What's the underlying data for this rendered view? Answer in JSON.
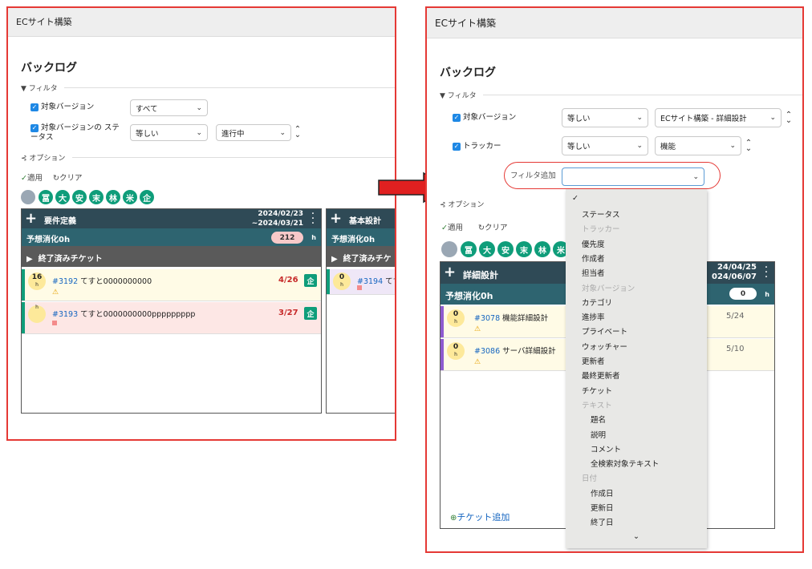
{
  "left": {
    "project_title": "ECサイト構築",
    "heading": "バックログ",
    "filter_section": "フィルタ",
    "filters": [
      {
        "label": "対象バージョン",
        "operator": "すべて"
      },
      {
        "label": "対象バージョンの ステータス",
        "operator": "等しい",
        "value": "進行中"
      }
    ],
    "options_section": "オプション",
    "apply": "適用",
    "clear": "クリア",
    "avatars": [
      "冨",
      "大",
      "安",
      "末",
      "林",
      "米",
      "企"
    ],
    "columns": [
      {
        "name": "要件定義",
        "dates": [
          "2024/02/23",
          "~2024/03/21"
        ],
        "estimate_label": "予想消化0h",
        "estimate_value": "212",
        "estimate_unit": "h",
        "closed_label": "終了済みチケット",
        "cards": [
          {
            "hours": "16",
            "unit": "h",
            "num": "#3192",
            "title": "てすと0000000000",
            "due": "4/26",
            "badge": "企",
            "warn": "⚠"
          },
          {
            "hours": "",
            "unit": "h",
            "num": "#3193",
            "title": "てすと0000000000ppppppppp",
            "due": "3/27",
            "badge": "企"
          }
        ]
      },
      {
        "name": "基本設計",
        "estimate_label": "予想消化0h",
        "closed_label": "終了済みチケ",
        "cards": [
          {
            "hours": "0",
            "unit": "h",
            "num": "#3194",
            "title": "てす"
          }
        ]
      }
    ]
  },
  "right": {
    "project_title": "ECサイト構築",
    "heading": "バックログ",
    "filter_section": "フィルタ",
    "filters": [
      {
        "label": "対象バージョン",
        "operator": "等しい",
        "value": "ECサイト構築 - 詳細設計"
      },
      {
        "label": "トラッカー",
        "operator": "等しい",
        "value": "機能"
      }
    ],
    "filter_add_label": "フィルタ追加",
    "options_section": "オプション",
    "apply": "適用",
    "clear": "クリア",
    "avatars": [
      "冨",
      "大",
      "安",
      "末",
      "林",
      "米"
    ],
    "column": {
      "name": "詳細設計",
      "dates": [
        "24/04/25",
        "024/06/07"
      ],
      "estimate_label": "予想消化0h",
      "estimate_value": "0",
      "estimate_unit": "h",
      "cards": [
        {
          "hours": "0",
          "unit": "h",
          "num": "#3078",
          "title": "機能詳細設計",
          "due": "5/24",
          "warn": "⚠"
        },
        {
          "hours": "0",
          "unit": "h",
          "num": "#3086",
          "title": "サーバ詳細設計",
          "due": "5/10",
          "warn": "⚠"
        }
      ]
    },
    "add_ticket": "チケット追加",
    "dropdown": {
      "check": "✓",
      "items": [
        {
          "label": "ステータス",
          "disabled": false
        },
        {
          "label": "トラッカー",
          "disabled": true
        },
        {
          "label": "優先度",
          "disabled": false
        },
        {
          "label": "作成者",
          "disabled": false
        },
        {
          "label": "担当者",
          "disabled": false
        },
        {
          "label": "対象バージョン",
          "disabled": true
        },
        {
          "label": "カテゴリ",
          "disabled": false
        },
        {
          "label": "進捗率",
          "disabled": false
        },
        {
          "label": "プライベート",
          "disabled": false
        },
        {
          "label": "ウォッチャー",
          "disabled": false
        },
        {
          "label": "更新者",
          "disabled": false
        },
        {
          "label": "最終更新者",
          "disabled": false
        },
        {
          "label": "チケット",
          "disabled": false
        },
        {
          "label": "テキスト",
          "disabled": true
        },
        {
          "label": "題名",
          "disabled": false,
          "indent": true
        },
        {
          "label": "説明",
          "disabled": false,
          "indent": true
        },
        {
          "label": "コメント",
          "disabled": false,
          "indent": true
        },
        {
          "label": "全検索対象テキスト",
          "disabled": false,
          "indent": true
        },
        {
          "label": "日付",
          "disabled": true
        },
        {
          "label": "作成日",
          "disabled": false,
          "indent": true
        },
        {
          "label": "更新日",
          "disabled": false,
          "indent": true
        },
        {
          "label": "終了日",
          "disabled": false,
          "indent": true
        }
      ]
    }
  },
  "colors": {
    "accent_red": "#e53935",
    "teal": "#0f9d7a",
    "header_dark": "#2f4a56",
    "link_blue": "#1565c0"
  }
}
